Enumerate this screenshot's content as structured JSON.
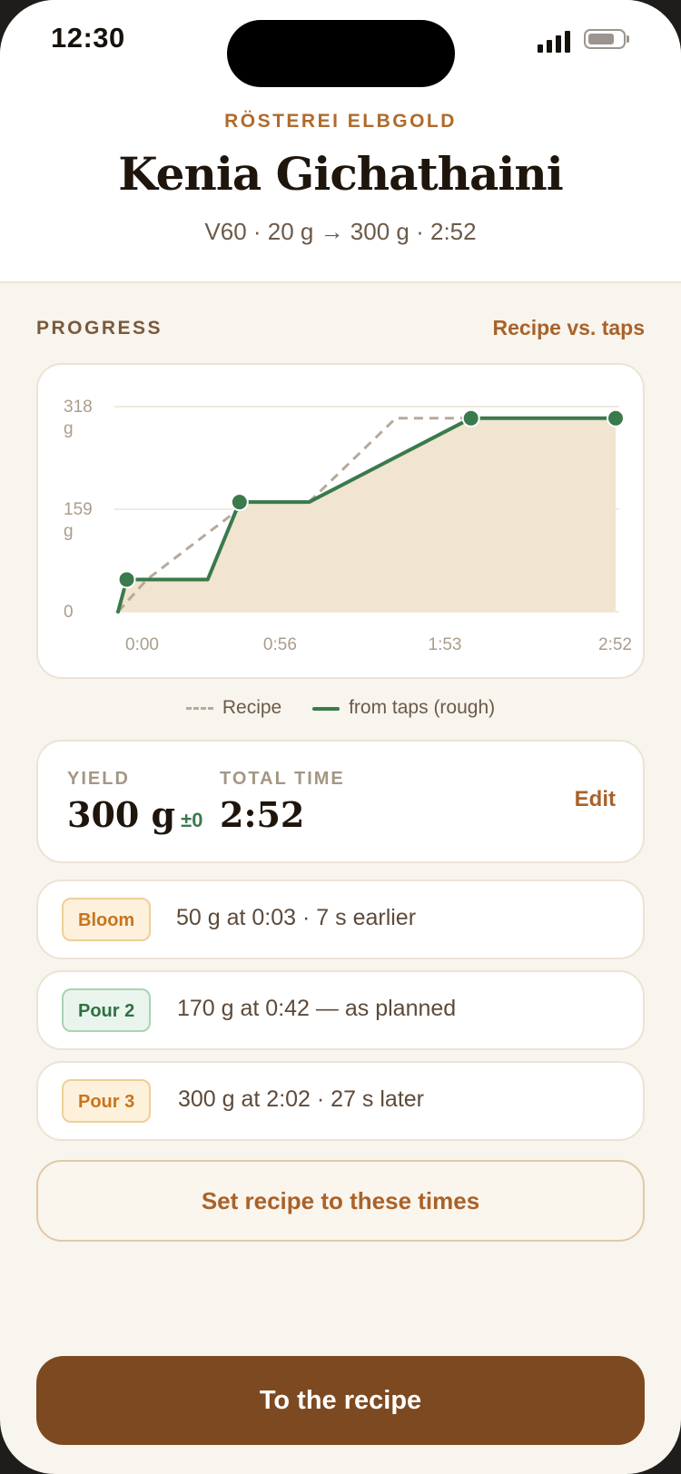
{
  "status_bar": {
    "time": "12:30"
  },
  "header": {
    "roaster": "RÖSTEREI ELBGOLD",
    "coffee_name": "Kenia Gichathaini",
    "meta": "V60 · 20 g → 300 g · 2:52"
  },
  "progress": {
    "title": "PROGRESS",
    "link": "Recipe vs. taps"
  },
  "chart_data": {
    "type": "line",
    "x_unit": "seconds",
    "xlim": [
      0,
      172
    ],
    "ylim": [
      0,
      318
    ],
    "y_ticks": [
      {
        "value": 318,
        "label": "318",
        "unit": "g"
      },
      {
        "value": 159,
        "label": "159",
        "unit": "g"
      },
      {
        "value": 0,
        "label": "0",
        "unit": ""
      }
    ],
    "x_ticks": [
      {
        "value": 0,
        "label": "0:00"
      },
      {
        "value": 56,
        "label": "0:56"
      },
      {
        "value": 113,
        "label": "1:53"
      },
      {
        "value": 172,
        "label": "2:52"
      }
    ],
    "grid": true,
    "series": [
      {
        "name": "Recipe",
        "style": "dashed",
        "color": "#b8a999",
        "points": [
          [
            0,
            0
          ],
          [
            10,
            50
          ],
          [
            45,
            170
          ],
          [
            66,
            170
          ],
          [
            96,
            300
          ],
          [
            172,
            300
          ]
        ]
      },
      {
        "name": "from taps (rough)",
        "style": "solid",
        "color": "#3a7a4c",
        "fill": "#f1e4d0",
        "points": [
          [
            0,
            0
          ],
          [
            3,
            50
          ],
          [
            31,
            50
          ],
          [
            42,
            170
          ],
          [
            66,
            170
          ],
          [
            122,
            300
          ],
          [
            172,
            300
          ]
        ],
        "markers": [
          [
            3,
            50
          ],
          [
            42,
            170
          ],
          [
            122,
            300
          ],
          [
            172,
            300
          ]
        ]
      }
    ]
  },
  "stats": {
    "yield_label": "YIELD",
    "yield_value": "300 g",
    "yield_delta": "±0",
    "time_label": "TOTAL TIME",
    "time_value": "2:52",
    "edit_label": "Edit"
  },
  "steps": [
    {
      "chip": "Bloom",
      "text": "50 g at 0:03 · 7 s earlier"
    },
    {
      "chip": "Pour 2",
      "text": "170 g at 0:42 — as planned"
    },
    {
      "chip": "Pour 3",
      "text": "300 g at 2:02 · 27 s later"
    }
  ],
  "set_button": "Set recipe to these times",
  "cta": "To the recipe",
  "colors": {
    "accent": "#a9622a",
    "primary_button": "#7d4920",
    "taps_line": "#3a7a4c",
    "recipe_line": "#b8a999",
    "area_fill": "#f1e4d0"
  }
}
